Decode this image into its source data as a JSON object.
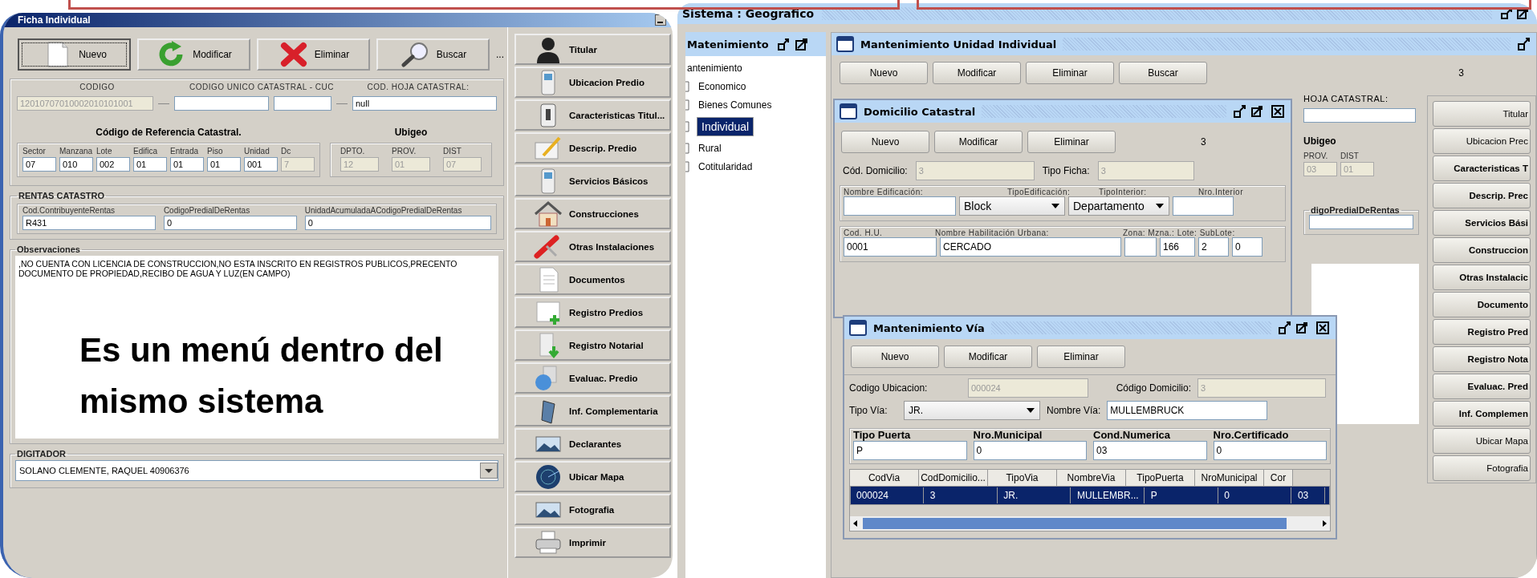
{
  "ficha": {
    "title": "Ficha Individual",
    "toolbar": [
      {
        "label": "Nuevo",
        "focused": true
      },
      {
        "label": "Modificar",
        "focused": false
      },
      {
        "label": "Eliminar",
        "focused": false
      },
      {
        "label": "Buscar",
        "focused": false
      }
    ],
    "more": "...",
    "code_labels": [
      "CODIGO",
      "CODIGO UNICO CATASTRAL - CUC",
      "COD. HOJA CATASTRAL:"
    ],
    "codigo": "12010707010002010101001",
    "hoja": "null",
    "ref_title": "Código de Referencia Catastral.",
    "ref_fields": [
      {
        "label": "Sector",
        "value": "07",
        "disabled": false
      },
      {
        "label": "Manzana",
        "value": "010",
        "disabled": false
      },
      {
        "label": "Lote",
        "value": "002",
        "disabled": false
      },
      {
        "label": "Edifica",
        "value": "01",
        "disabled": false
      },
      {
        "label": "Entrada",
        "value": "01",
        "disabled": false
      },
      {
        "label": "Piso",
        "value": "01",
        "disabled": false
      },
      {
        "label": "Unidad",
        "value": "001",
        "disabled": false
      },
      {
        "label": "Dc",
        "value": "7",
        "disabled": true
      }
    ],
    "ubigeo_title": "Ubigeo",
    "ubigeo_fields": [
      {
        "label": "DPTO.",
        "value": "12",
        "disabled": true
      },
      {
        "label": "PROV.",
        "value": "01",
        "disabled": true
      },
      {
        "label": "DIST",
        "value": "07",
        "disabled": true
      }
    ],
    "rentas": {
      "title": "RENTAS CATASTRO",
      "fields": [
        {
          "label": "Cod.ContribuyenteRentas",
          "value": "R431"
        },
        {
          "label": "CodigoPredialDeRentas",
          "value": "0"
        },
        {
          "label": "UnidadAcumuladaACodigoPredialDeRentas",
          "value": "0"
        }
      ]
    },
    "observaciones": {
      "title": "Observaciones",
      "text": ",NO CUENTA CON LICENCIA DE CONSTRUCCION,NO ESTA INSCRITO EN REGISTROS PUBLICOS,PRECENTO DOCUMENTO DE PROPIEDAD,RECIBO DE AGUA Y LUZ(EN CAMPO)"
    },
    "digitador": {
      "title": "DIGITADOR",
      "value": "SOLANO CLEMENTE, RAQUEL 40906376"
    },
    "menu": [
      "Titular",
      "Ubicacion Predio",
      "Caracteristicas Titul...",
      "Descrip. Predio",
      "Servicios Básicos",
      "Construcciones",
      "Otras Instalaciones",
      "Documentos",
      "Registro Predios",
      "Registro Notarial",
      "Evaluac. Predio",
      "Inf. Complementaria",
      "Declarantes",
      "Ubicar Mapa",
      "Fotografia",
      "Imprimir"
    ]
  },
  "annotation": "Es un menú dentro del mismo sistema",
  "sistema": {
    "title": "Sistema : Geografico",
    "tree": {
      "title": "Matenimiento",
      "root": "antenimiento",
      "children": [
        {
          "label": "Economico",
          "selected": false
        },
        {
          "label": "Bienes Comunes",
          "selected": false
        },
        {
          "label": "Individual",
          "selected": true
        },
        {
          "label": "Rural",
          "selected": false
        },
        {
          "label": "Cotitularidad",
          "selected": false
        }
      ]
    },
    "unidad": {
      "title": "Mantenimiento Unidad Individual",
      "buttons": [
        "Nuevo",
        "Modificar",
        "Eliminar",
        "Buscar"
      ],
      "count": "3",
      "hoja_label": "HOJA CATASTRAL:",
      "ubigeo_title": "Ubigeo",
      "ubigeo_fields": [
        {
          "label": "PROV.",
          "value": "03"
        },
        {
          "label": "DIST",
          "value": "01"
        }
      ],
      "rentas_label": "digoPredialDeRentas",
      "menu": [
        {
          "label": "Titular",
          "bold": false
        },
        {
          "label": "Ubicacion Prec",
          "bold": false
        },
        {
          "label": "Caracteristicas T",
          "bold": true
        },
        {
          "label": "Descrip. Prec",
          "bold": true
        },
        {
          "label": "Servicios Bási",
          "bold": true
        },
        {
          "label": "Construccion",
          "bold": true
        },
        {
          "label": "Otras Instalacic",
          "bold": true
        },
        {
          "label": "Documento",
          "bold": true
        },
        {
          "label": "Registro Pred",
          "bold": true
        },
        {
          "label": "Registro Nota",
          "bold": true
        },
        {
          "label": "Evaluac. Pred",
          "bold": true
        },
        {
          "label": "Inf. Complemen",
          "bold": true
        },
        {
          "label": "Ubicar Mapa",
          "bold": false
        },
        {
          "label": "Fotografia",
          "bold": false
        }
      ]
    },
    "domicilio": {
      "title": "Domicilio Catastral",
      "buttons": [
        "Nuevo",
        "Modificar",
        "Eliminar"
      ],
      "count": "3",
      "cod_label": "Cód. Domicilio:",
      "cod_value": "3",
      "ficha_label": "Tipo Ficha:",
      "ficha_value": "3",
      "edif_labels": [
        "Nombre Edificación:",
        "TipoEdificación:",
        "TipoInterior:",
        "Nro.Interior"
      ],
      "tipo_edif": "Block",
      "tipo_interior": "Departamento",
      "hu_labels": [
        "Cod. H.U.",
        "Nombre Habilitación Urbana:",
        "Zona: Mzna.: Lote: SubLote:"
      ],
      "cod_hu": "0001",
      "nombre_hu": "CERCADO",
      "mzna": "166",
      "lote": "2",
      "sublote": "0"
    },
    "via": {
      "title": "Mantenimiento Vía",
      "buttons": [
        "Nuevo",
        "Modificar",
        "Eliminar"
      ],
      "cod_ubic_label": "Codigo Ubicacion:",
      "cod_ubic": "000024",
      "cod_dom_label": "Código Domicilio:",
      "cod_dom": "3",
      "tipo_label": "Tipo Vía:",
      "tipo": "JR.",
      "nombre_label": "Nombre Vía:",
      "nombre": "MULLEMBRUCK",
      "fields": [
        {
          "label": "Tipo Puerta",
          "value": "P"
        },
        {
          "label": "Nro.Municipal",
          "value": "0"
        },
        {
          "label": "Cond.Numerica",
          "value": "03"
        },
        {
          "label": "Nro.Certificado",
          "value": "0"
        }
      ],
      "table": {
        "columns": [
          "CodVia",
          "CodDomicilio...",
          "TipoVia",
          "NombreVia",
          "TipoPuerta",
          "NroMunicipal",
          "Cor"
        ],
        "rows": [
          {
            "cells": [
              "000024",
              "3",
              "JR.",
              "MULLEMBR...",
              "P",
              "0",
              "03"
            ],
            "selected": true
          }
        ]
      }
    }
  }
}
